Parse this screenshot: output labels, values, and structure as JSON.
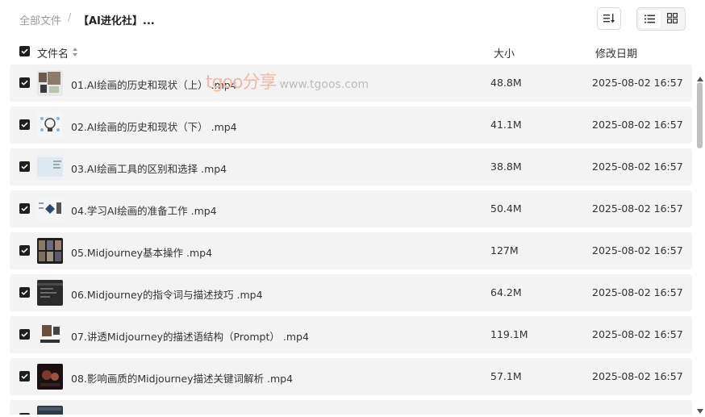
{
  "breadcrumb": {
    "root": "全部文件",
    "separator": "/",
    "current": "【AI进化社】..."
  },
  "toolbar": {
    "sort_icon": "sort-list-icon",
    "view_list_icon": "list-view-icon",
    "view_grid_icon": "grid-view-icon",
    "active_view": "list"
  },
  "columns": {
    "name": "文件名",
    "size": "大小",
    "date": "修改日期"
  },
  "watermark": {
    "brand": "tgoo分享",
    "url": "www.tgoos.com"
  },
  "files": [
    {
      "name": "01.AI绘画的历史和现状（上） .mp4",
      "size": "48.8M",
      "date": "2025-08-02 16:57",
      "checked": true
    },
    {
      "name": "02.AI绘画的历史和现状（下） .mp4",
      "size": "41.1M",
      "date": "2025-08-02 16:57",
      "checked": true
    },
    {
      "name": "03.AI绘画工具的区别和选择 .mp4",
      "size": "38.8M",
      "date": "2025-08-02 16:57",
      "checked": true
    },
    {
      "name": "04.学习AI绘画的准备工作 .mp4",
      "size": "50.4M",
      "date": "2025-08-02 16:57",
      "checked": true
    },
    {
      "name": "05.Midjourney基本操作 .mp4",
      "size": "127M",
      "date": "2025-08-02 16:57",
      "checked": true
    },
    {
      "name": "06.Midjourney的指令词与描述技巧 .mp4",
      "size": "64.2M",
      "date": "2025-08-02 16:57",
      "checked": true
    },
    {
      "name": "07.讲透Midjourney的描述语结构（Prompt） .mp4",
      "size": "119.1M",
      "date": "2025-08-02 16:57",
      "checked": true
    },
    {
      "name": "08.影响画质的Midjourney描述关键词解析 .mp4",
      "size": "57.1M",
      "date": "2025-08-02 16:57",
      "checked": true
    },
    {
      "name": "",
      "size": "",
      "date": "",
      "checked": true
    }
  ]
}
